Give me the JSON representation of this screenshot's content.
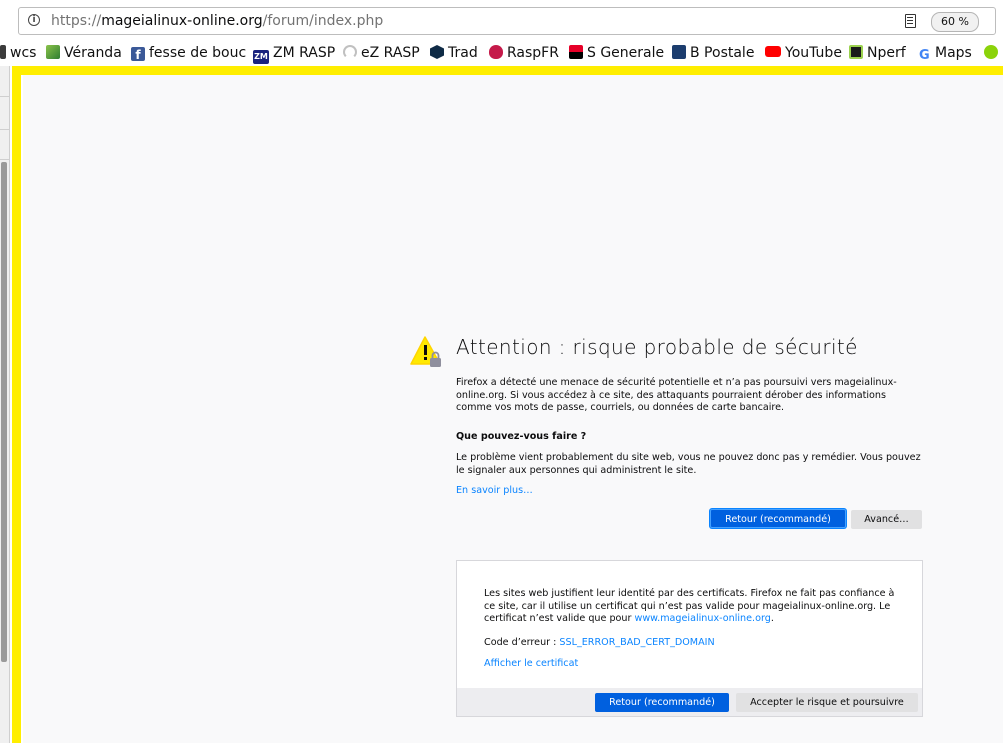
{
  "toolbar": {
    "url_prefix": "https://",
    "url_host": "mageialinux-online.org",
    "url_path": "/forum/index.php",
    "zoom": "60 %"
  },
  "bookmarks": [
    {
      "label": "wcs",
      "icon": "document-icon",
      "color": "#3b3b3b"
    },
    {
      "label": "Véranda",
      "icon": "pv-logo-icon",
      "color": "#4caf50"
    },
    {
      "label": "fesse de bouc",
      "icon": "facebook-icon",
      "color": "#3b5998"
    },
    {
      "label": "ZM RASP",
      "icon": "zm-logo-icon",
      "color": "#1a237e"
    },
    {
      "label": "eZ RASP",
      "icon": "gauge-icon",
      "color": "#c0c0c0"
    },
    {
      "label": "Trad",
      "icon": "deepl-icon",
      "color": "#0f2b46"
    },
    {
      "label": "RaspFR",
      "icon": "raspberry-icon",
      "color": "#c51a4a"
    },
    {
      "label": "S Generale",
      "icon": "sg-logo-icon",
      "color": "#e60028"
    },
    {
      "label": "B Postale",
      "icon": "bank-icon",
      "color": "#1c3d6e"
    },
    {
      "label": "YouTube",
      "icon": "youtube-icon",
      "color": "#ff0000"
    },
    {
      "label": "Nperf",
      "icon": "nperf-icon",
      "color": "#1a1a1a"
    },
    {
      "label": "Maps",
      "icon": "google-icon",
      "color": "#4285f4"
    }
  ],
  "error": {
    "title": "Attention : risque probable de sécurité",
    "intro": "Firefox a détecté une menace de sécurité potentielle et n’a pas poursuivi vers mageialinux-online.org. Si vous accédez à ce site, des attaquants pourraient dérober des informations comme vos mots de passe, courriels, ou données de carte bancaire.",
    "what_heading": "Que pouvez-vous faire ?",
    "what_text": "Le problème vient probablement du site web, vous ne pouvez donc pas y remédier. Vous pouvez le signaler aux personnes qui administrent le site.",
    "learn_more": "En savoir plus…",
    "back_button": "Retour (recommandé)",
    "advanced_button": "Avancé…",
    "advanced": {
      "text_before": "Les sites web justifient leur identité par des certificats. Firefox ne fait pas confiance à ce site, car il utilise un certificat qui n’est pas valide pour mageialinux-online.org. Le certificat n’est valide que pour ",
      "valid_host": "www.mageialinux-online.org",
      "text_after": ".",
      "error_code_label": "Code d’erreur : ",
      "error_code": "SSL_ERROR_BAD_CERT_DOMAIN",
      "show_certificate": "Afficher le certificat",
      "back_button": "Retour (recommandé)",
      "accept_button": "Accepter le risque et poursuivre"
    }
  },
  "colors": {
    "frame_border": "#ffee00",
    "primary_button": "#0060df",
    "link": "#0a84ff",
    "warning": "#ffe900"
  }
}
